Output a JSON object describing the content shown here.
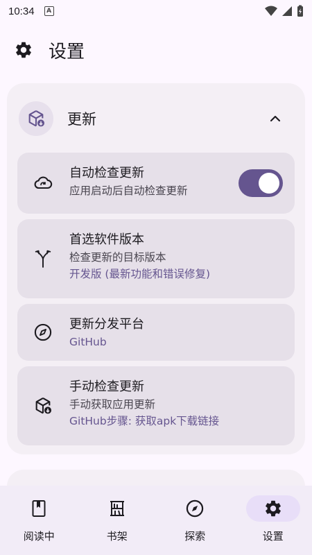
{
  "status_bar": {
    "time": "10:34",
    "notification_glyph": "A"
  },
  "app_bar": {
    "title": "设置"
  },
  "section": {
    "title": "更新",
    "items": [
      {
        "title": "自动检查更新",
        "subtitle": "应用启动后自动检查更新",
        "toggle_on": true
      },
      {
        "title": "首选软件版本",
        "subtitle": "检查更新的目标版本",
        "value": "开发版 (最新功能和错误修复)"
      },
      {
        "title": "更新分发平台",
        "value": "GitHub"
      },
      {
        "title": "手动检查更新",
        "subtitle": "手动获取应用更新",
        "value": "GitHub步骤: 获取apk下载链接"
      }
    ]
  },
  "bottom_nav": {
    "items": [
      {
        "label": "阅读中",
        "icon": "book-icon"
      },
      {
        "label": "书架",
        "icon": "bookshelf-icon"
      },
      {
        "label": "探索",
        "icon": "compass-icon"
      },
      {
        "label": "设置",
        "icon": "gear-icon",
        "active": true
      }
    ]
  },
  "colors": {
    "accent": "#65558f",
    "card": "#f4eff5",
    "item": "#e6e0e9",
    "nav_active": "#e8def8"
  }
}
